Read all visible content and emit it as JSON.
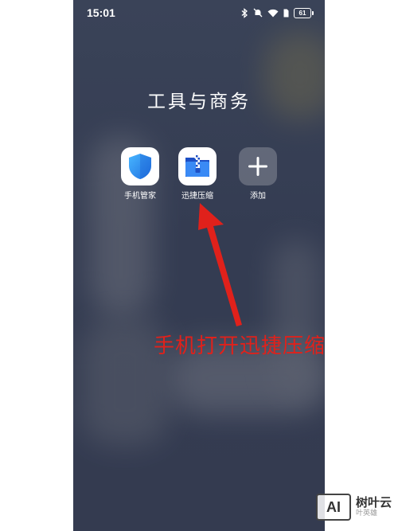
{
  "status_bar": {
    "time": "15:01",
    "battery": "61",
    "icons": [
      "bluetooth-icon",
      "mute-icon",
      "wifi-icon",
      "sim-icon"
    ]
  },
  "folder": {
    "title": "工具与商务",
    "apps": [
      {
        "label": "手机管家",
        "icon": "shield-icon",
        "color": "#2e8bf0"
      },
      {
        "label": "迅捷压缩",
        "icon": "zip-folder-icon",
        "color": "#2f6fe8"
      },
      {
        "label": "添加",
        "icon": "plus-icon",
        "color": "#ffffff"
      }
    ]
  },
  "annotation": {
    "text": "手机打开迅捷压缩",
    "color": "#e0211b"
  },
  "watermark": {
    "logo": "AI",
    "name": "树叶云",
    "sub": "叶英雄"
  }
}
